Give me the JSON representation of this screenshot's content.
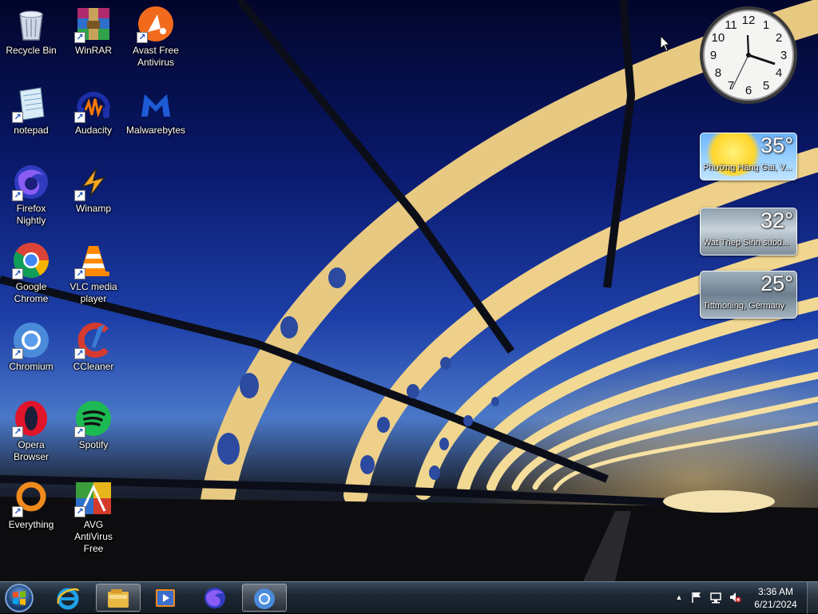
{
  "desktop": {
    "icons": [
      {
        "label": "Recycle Bin",
        "icon": "recycle-bin-icon",
        "shortcut": false
      },
      {
        "label": "WinRAR",
        "icon": "winrar-icon",
        "shortcut": true
      },
      {
        "label": "Avast Free Antivirus",
        "icon": "avast-icon",
        "shortcut": true
      },
      {
        "label": "notepad",
        "icon": "notepad-icon",
        "shortcut": true
      },
      {
        "label": "Audacity",
        "icon": "audacity-icon",
        "shortcut": true
      },
      {
        "label": "Malwarebytes",
        "icon": "malwarebytes-icon",
        "shortcut": false
      },
      {
        "label": "Firefox Nightly",
        "icon": "firefox-nightly-icon",
        "shortcut": true
      },
      {
        "label": "Winamp",
        "icon": "winamp-icon",
        "shortcut": true
      },
      {
        "label": "Google Chrome",
        "icon": "chrome-icon",
        "shortcut": true
      },
      {
        "label": "VLC media player",
        "icon": "vlc-icon",
        "shortcut": true
      },
      {
        "label": "Chromium",
        "icon": "chromium-icon",
        "shortcut": true
      },
      {
        "label": "CCleaner",
        "icon": "ccleaner-icon",
        "shortcut": true
      },
      {
        "label": "Opera Browser",
        "icon": "opera-icon",
        "shortcut": true
      },
      {
        "label": "Spotify",
        "icon": "spotify-icon",
        "shortcut": true
      },
      {
        "label": "Everything",
        "icon": "everything-icon",
        "shortcut": true
      },
      {
        "label": "AVG AntiVirus Free",
        "icon": "avg-icon",
        "shortcut": true
      }
    ]
  },
  "gadgets": {
    "clock": {
      "numerals": [
        "12",
        "1",
        "2",
        "3",
        "4",
        "5",
        "6",
        "7",
        "8",
        "9",
        "10",
        "11"
      ]
    },
    "weather": [
      {
        "temp": "35°",
        "location": "Phường Hàng Gai, V..."
      },
      {
        "temp": "32°",
        "location": "Wat Thep Sirin subd..."
      },
      {
        "temp": "25°",
        "location": "Tittmoning, Germany"
      }
    ]
  },
  "taskbar": {
    "pinned": [
      {
        "icon": "internet-explorer-icon"
      },
      {
        "icon": "windows-explorer-icon"
      },
      {
        "icon": "media-player-icon"
      },
      {
        "icon": "firefox-nightly-icon"
      },
      {
        "icon": "chromium-icon"
      }
    ],
    "tray": {
      "time": "3:36 AM",
      "date": "6/21/2024",
      "show_hidden": "▲"
    }
  },
  "colors": {
    "taskbar": "#1d2733",
    "sky_top": "#02052a",
    "sky_mid": "#1d3fa8",
    "bridge_light": "#f2d58a"
  }
}
